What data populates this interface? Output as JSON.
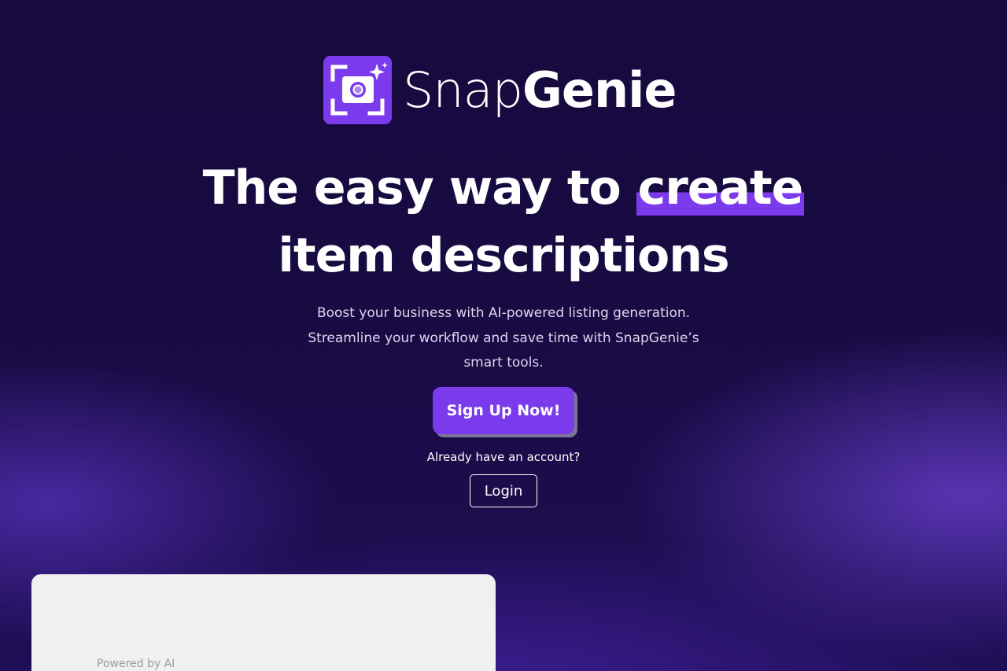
{
  "brand": {
    "name_light": "Snap",
    "name_bold": "Genie",
    "icon": "camera-sparkle-icon",
    "accent_color": "#7c3aed"
  },
  "hero": {
    "headline_before": "The easy way to ",
    "headline_highlight": "create",
    "headline_after": "item descriptions",
    "subtext_line1": "Boost your business with AI-powered listing generation.",
    "subtext_line2": "Streamline your workflow and save time with SnapGenie’s",
    "subtext_line3": "smart tools."
  },
  "cta": {
    "signup_label": "Sign Up Now!",
    "already_text": "Already have an account?",
    "login_label": "Login"
  },
  "preview_card": {
    "label": "Powered by AI"
  }
}
